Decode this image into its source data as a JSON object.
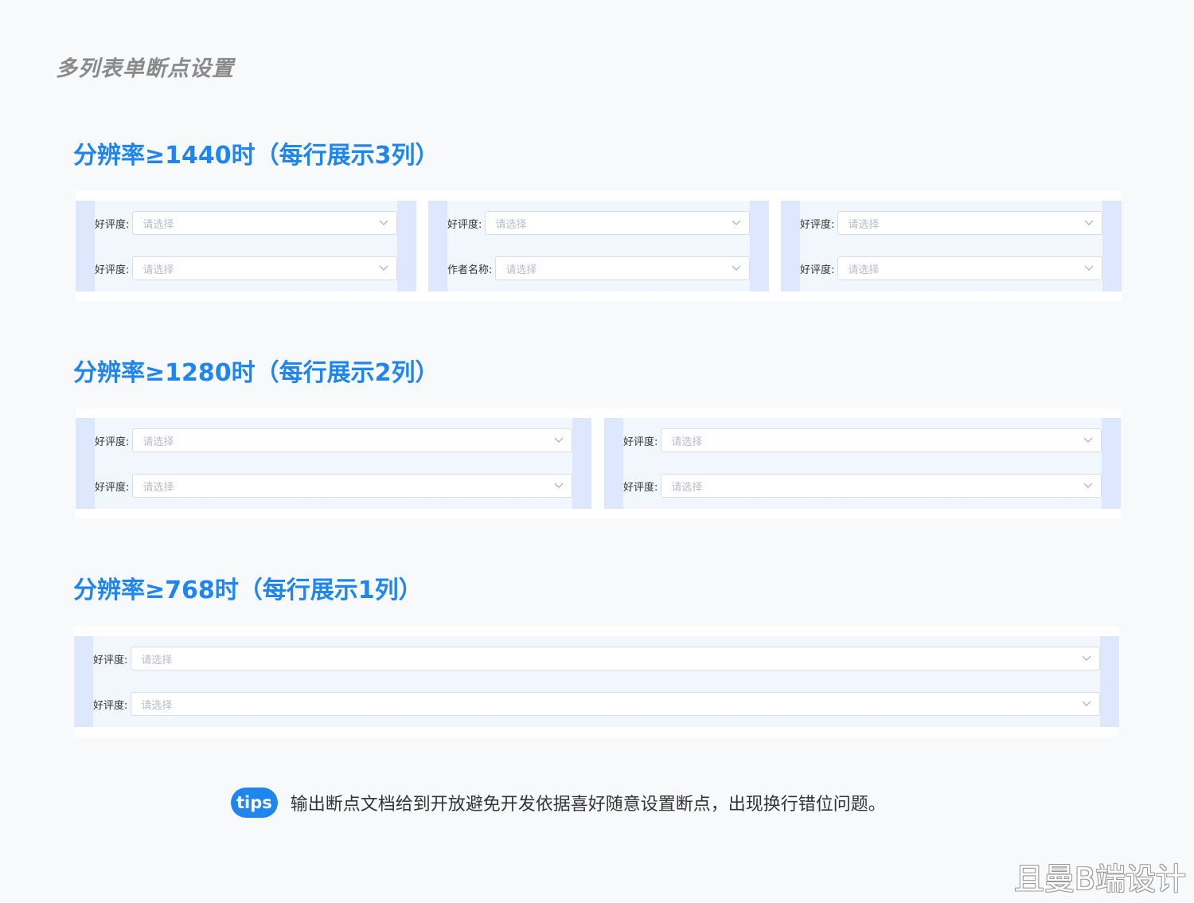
{
  "page_title": "多列表单断点设置",
  "sections": [
    {
      "title": "分辨率≥1440时（每行展示3列）",
      "cards": [
        {
          "rows": [
            {
              "label": "好评度:",
              "placeholder": "请选择"
            },
            {
              "label": "好评度:",
              "placeholder": "请选择"
            }
          ]
        },
        {
          "rows": [
            {
              "label": "好评度:",
              "placeholder": "请选择"
            },
            {
              "label": "作者名称:",
              "placeholder": "请选择"
            }
          ]
        },
        {
          "rows": [
            {
              "label": "好评度:",
              "placeholder": "请选择"
            },
            {
              "label": "好评度:",
              "placeholder": "请选择"
            }
          ]
        }
      ]
    },
    {
      "title": "分辨率≥1280时（每行展示2列）",
      "cards": [
        {
          "rows": [
            {
              "label": "好评度:",
              "placeholder": "请选择"
            },
            {
              "label": "好评度:",
              "placeholder": "请选择"
            }
          ]
        },
        {
          "rows": [
            {
              "label": "好评度:",
              "placeholder": "请选择"
            },
            {
              "label": "好评度:",
              "placeholder": "请选择"
            }
          ]
        }
      ]
    },
    {
      "title": "分辨率≥768时（每行展示1列）",
      "cards": [
        {
          "rows": [
            {
              "label": "好评度:",
              "placeholder": "请选择"
            },
            {
              "label": "好评度:",
              "placeholder": "请选择"
            }
          ]
        }
      ]
    }
  ],
  "tips": {
    "badge": "tips",
    "text": "输出断点文档给到开放避免开发依据喜好随意设置断点，出现换行错位问题。"
  },
  "watermark": "且曼B端设计",
  "colors": {
    "accent": "#1f86f0",
    "card_edge": "#dde7fd",
    "card_fill": "#f2f7fe"
  }
}
